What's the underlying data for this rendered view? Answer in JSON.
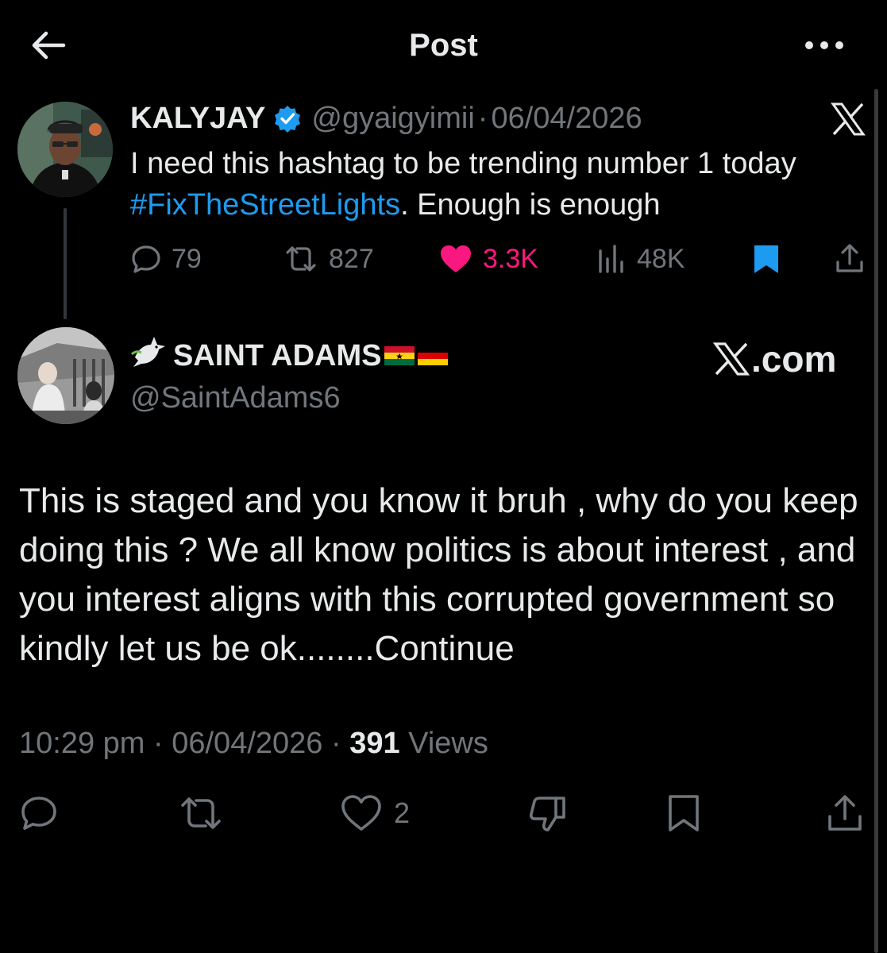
{
  "header": {
    "title": "Post",
    "back_icon": "arrow-left-icon",
    "more_icon": "more-horizontal-icon"
  },
  "quoted_post": {
    "display_name": "KALYJAY",
    "verified": true,
    "handle": "@gyaigyimii",
    "separator": "·",
    "date": "06/04/2026",
    "text_before": "I need this hashtag to be trending number 1 today",
    "hashtag": "#FixTheStreetLights",
    "text_after": ". Enough is enough",
    "stats": {
      "replies": "79",
      "reposts": "827",
      "likes": "3.3K",
      "views": "48K"
    },
    "liked": true,
    "bookmarked": true
  },
  "reply_post": {
    "name_emoji": "🕊",
    "display_name": "SAINT ADAMS",
    "flags": [
      "ghana-flag",
      "germany-flag"
    ],
    "handle": "@SaintAdams6",
    "watermark": ".com",
    "body": "This is staged and you know it bruh , why do you keep doing this ? We all know politics is about interest , and you interest aligns with this corrupted government so kindly let us be ok........Continue",
    "time": "10:29 pm",
    "separator": "·",
    "date": "06/04/2026",
    "views_count": "391",
    "views_label": "Views",
    "likes": "2"
  },
  "colors": {
    "background": "#000000",
    "text_primary": "#e7e9ea",
    "text_secondary": "#71767b",
    "link": "#1d9bf0",
    "like": "#f91880",
    "verified": "#1d9bf0"
  }
}
